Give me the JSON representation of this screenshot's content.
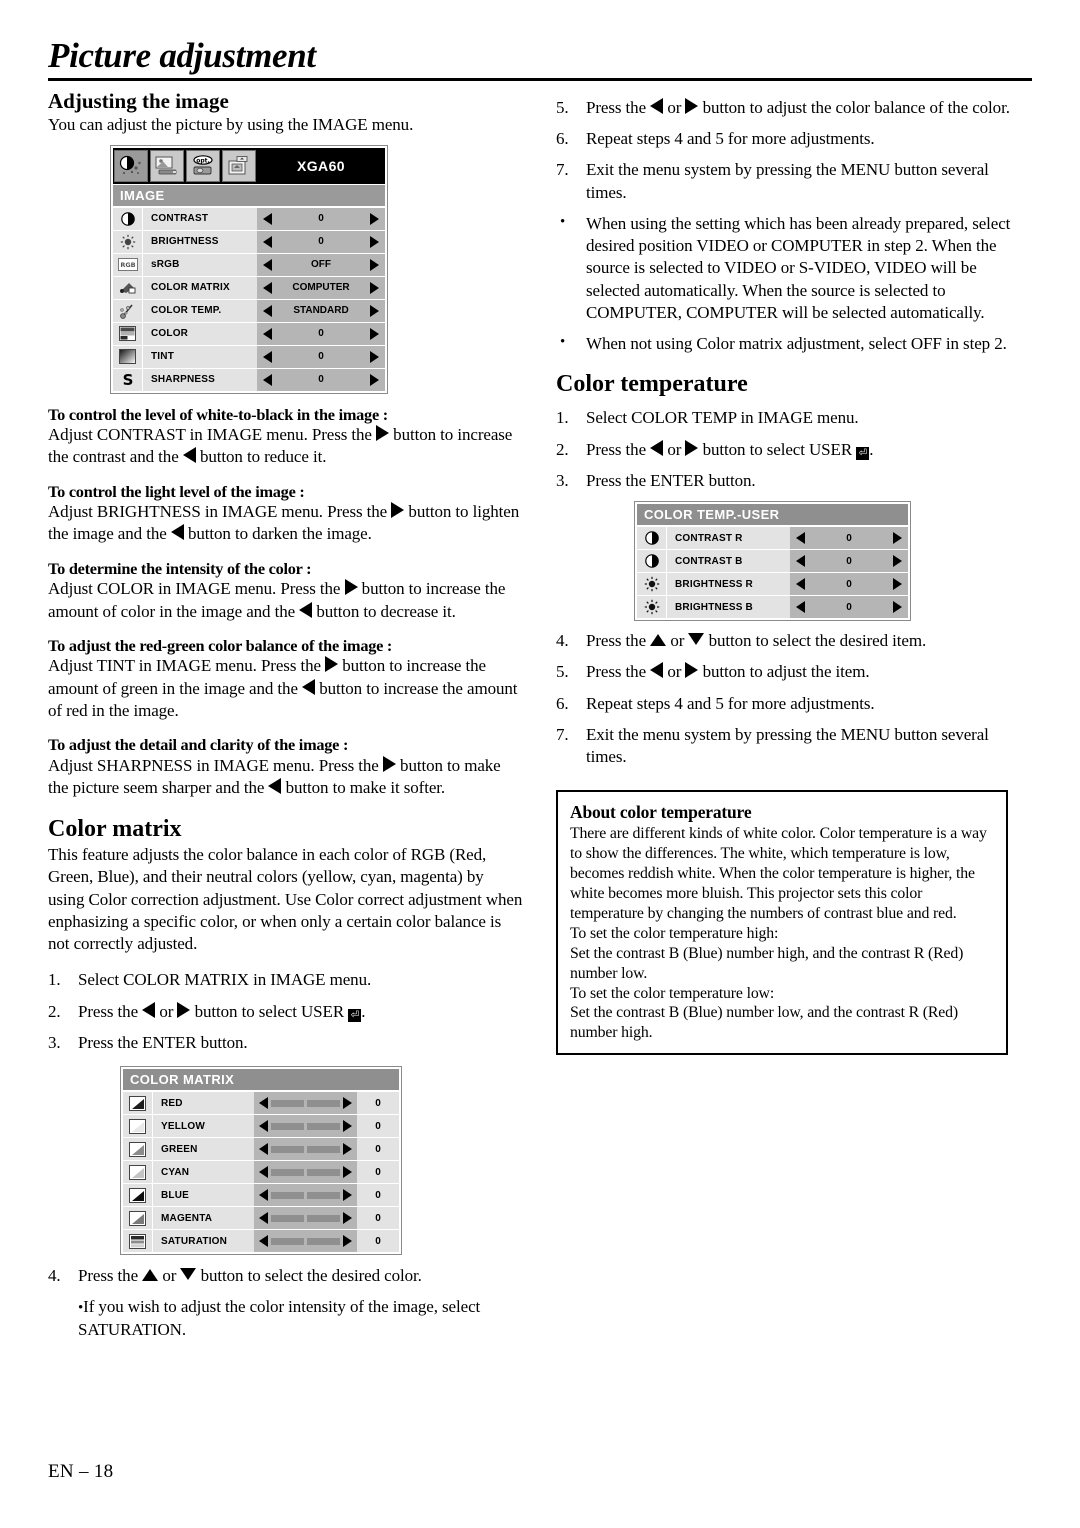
{
  "page": {
    "title": "Picture adjustment",
    "footer": "EN – 18"
  },
  "left_column": {
    "adjusting_heading": "Adjusting the image",
    "adjusting_intro": "You can adjust the picture by using the IMAGE menu.",
    "image_menu": {
      "source_name": "XGA60",
      "title": "IMAGE",
      "tabs": [
        {
          "name": "image-tab",
          "icon": "contrast-circle-icon",
          "active": true
        },
        {
          "name": "installation-tab",
          "icon": "installation-icon",
          "active": false
        },
        {
          "name": "option-tab",
          "icon": "opt-projector-icon",
          "active": false
        },
        {
          "name": "signal-tab",
          "icon": "signal-screen-icon",
          "active": false
        }
      ],
      "rows": [
        {
          "icon": "contrast-circle-icon",
          "label": "CONTRAST",
          "value": "0"
        },
        {
          "icon": "brightness-sun-icon",
          "label": "BRIGHTNESS",
          "value": "0"
        },
        {
          "icon": "srgb-icon",
          "label": "sRGB",
          "value": "OFF"
        },
        {
          "icon": "color-matrix-icon",
          "label": "COLOR MATRIX",
          "value": "COMPUTER"
        },
        {
          "icon": "color-temp-icon",
          "label": "COLOR TEMP.",
          "value": "STANDARD"
        },
        {
          "icon": "color-bars-icon",
          "label": "COLOR",
          "value": "0"
        },
        {
          "icon": "tint-gradient-icon",
          "label": "TINT",
          "value": "0"
        },
        {
          "icon": "sharpness-s-icon",
          "label": "SHARPNESS",
          "value": "0"
        }
      ]
    },
    "sections": [
      {
        "heading": "To control the level of white-to-black in the image :",
        "body_parts": [
          "Adjust CONTRAST in IMAGE menu.  Press the ",
          " button to increase the contrast and the ",
          " button to reduce it."
        ]
      },
      {
        "heading": "To control the light level of the image :",
        "body_parts": [
          "Adjust BRIGHTNESS in IMAGE menu.  Press the ",
          " button to lighten the image and the ",
          " button to darken the image."
        ]
      },
      {
        "heading": "To determine the intensity of the color :",
        "body_parts": [
          "Adjust COLOR in IMAGE menu.  Press the ",
          " button to increase the amount of color in the image and the ",
          " button to decrease it."
        ]
      },
      {
        "heading": "To adjust the red-green color balance of the image :",
        "body_parts": [
          "Adjust TINT in IMAGE menu.  Press the ",
          " button to increase the amount of green in the image and the ",
          " button to increase the amount of red in the image."
        ]
      },
      {
        "heading": "To adjust the detail and clarity of the image :",
        "body_parts": [
          "Adjust SHARPNESS in IMAGE menu.  Press the ",
          " button to make the picture seem sharper and the ",
          " button to make it softer."
        ]
      }
    ],
    "color_matrix": {
      "heading": "Color matrix",
      "intro": "This feature adjusts the color balance in each color of RGB (Red, Green, Blue), and their neutral colors (yellow, cyan, magenta) by using Color correction adjustment. Use Color correct adjustment when enphasizing a specific color, or when only a certain color balance is not correctly adjusted.",
      "steps": [
        {
          "num": "1.",
          "text": "Select COLOR MATRIX in IMAGE menu."
        },
        {
          "num": "2.",
          "pre": "Press the ",
          "mid": " or ",
          "post": " button to select USER ",
          "tail": "."
        },
        {
          "num": "3.",
          "text": "Press the ENTER button."
        }
      ],
      "menu": {
        "title": "COLOR MATRIX",
        "rows": [
          {
            "icon": "red-triangle-icon",
            "label": "RED",
            "value": "0"
          },
          {
            "icon": "yellow-triangle-icon",
            "label": "YELLOW",
            "value": "0"
          },
          {
            "icon": "green-triangle-icon",
            "label": "GREEN",
            "value": "0"
          },
          {
            "icon": "cyan-triangle-icon",
            "label": "CYAN",
            "value": "0"
          },
          {
            "icon": "blue-triangle-icon",
            "label": "BLUE",
            "value": "0"
          },
          {
            "icon": "magenta-triangle-icon",
            "label": "MAGENTA",
            "value": "0"
          },
          {
            "icon": "saturation-bars-icon",
            "label": "SATURATION",
            "value": "0"
          }
        ]
      },
      "step4": {
        "num": "4.",
        "pre": "Press the ",
        "mid": " or ",
        "post": " button to select the desired color."
      },
      "step4_bullet": "If you wish to adjust the color intensity of the image, select SATURATION."
    }
  },
  "right_column": {
    "matrix_steps": [
      {
        "num": "5.",
        "pre": "Press the ",
        "mid": " or ",
        "post": " button to adjust the color balance of the color."
      },
      {
        "num": "6.",
        "text": "Repeat steps 4 and 5 for more adjustments."
      },
      {
        "num": "7.",
        "text": "Exit the menu system by pressing the MENU button several times."
      }
    ],
    "matrix_bullets": [
      "When using the setting which has been already prepared, select desired position VIDEO or COMPUTER in step 2.  When the source is selected to VIDEO or S-VIDEO, VIDEO will be selected automatically. When the source is selected to COMPUTER, COMPUTER will be selected automatically.",
      "When not using Color matrix adjustment, select OFF in step 2."
    ],
    "color_temperature": {
      "heading": "Color temperature",
      "steps_top": [
        {
          "num": "1.",
          "text": "Select COLOR TEMP in IMAGE menu."
        },
        {
          "num": "2.",
          "pre": "Press the ",
          "mid": " or ",
          "post": " button to select USER ",
          "tail": "."
        },
        {
          "num": "3.",
          "text": "Press the ENTER button."
        }
      ],
      "menu": {
        "title": "COLOR TEMP.-USER",
        "rows": [
          {
            "icon": "contrast-circle-icon",
            "label": "CONTRAST R",
            "value": "0"
          },
          {
            "icon": "contrast-circle-icon",
            "label": "CONTRAST B",
            "value": "0"
          },
          {
            "icon": "brightness-sun-icon",
            "label": "BRIGHTNESS R",
            "value": "0"
          },
          {
            "icon": "brightness-sun-icon",
            "label": "BRIGHTNESS B",
            "value": "0"
          }
        ]
      },
      "steps_bottom": [
        {
          "num": "4.",
          "pre": "Press the ",
          "mid": " or ",
          "post": " button to select the desired item."
        },
        {
          "num": "5.",
          "pre": "Press the ",
          "mid": " or ",
          "post": " button to adjust the item."
        },
        {
          "num": "6.",
          "text": "Repeat steps 4 and 5 for more adjustments."
        },
        {
          "num": "7.",
          "text": "Exit the menu system by pressing the MENU button several times."
        }
      ]
    },
    "about_box": {
      "heading": "About color temperature",
      "paragraph": "There are different kinds of white color. Color temperature is a way to show the differences. The white, which temperature is low, becomes reddish white. When the color temperature is higher, the white becomes more bluish. This projector sets this color temperature by changing the numbers of contrast blue and red.",
      "line_high_label": "To set the color temperature high:",
      "line_high_text": "Set the contrast B (Blue) number high, and the contrast R (Red) number low.",
      "line_low_label": "To set the color temperature low:",
      "line_low_text": "Set the contrast B (Blue) number low, and the contrast R (Red) number high."
    }
  }
}
